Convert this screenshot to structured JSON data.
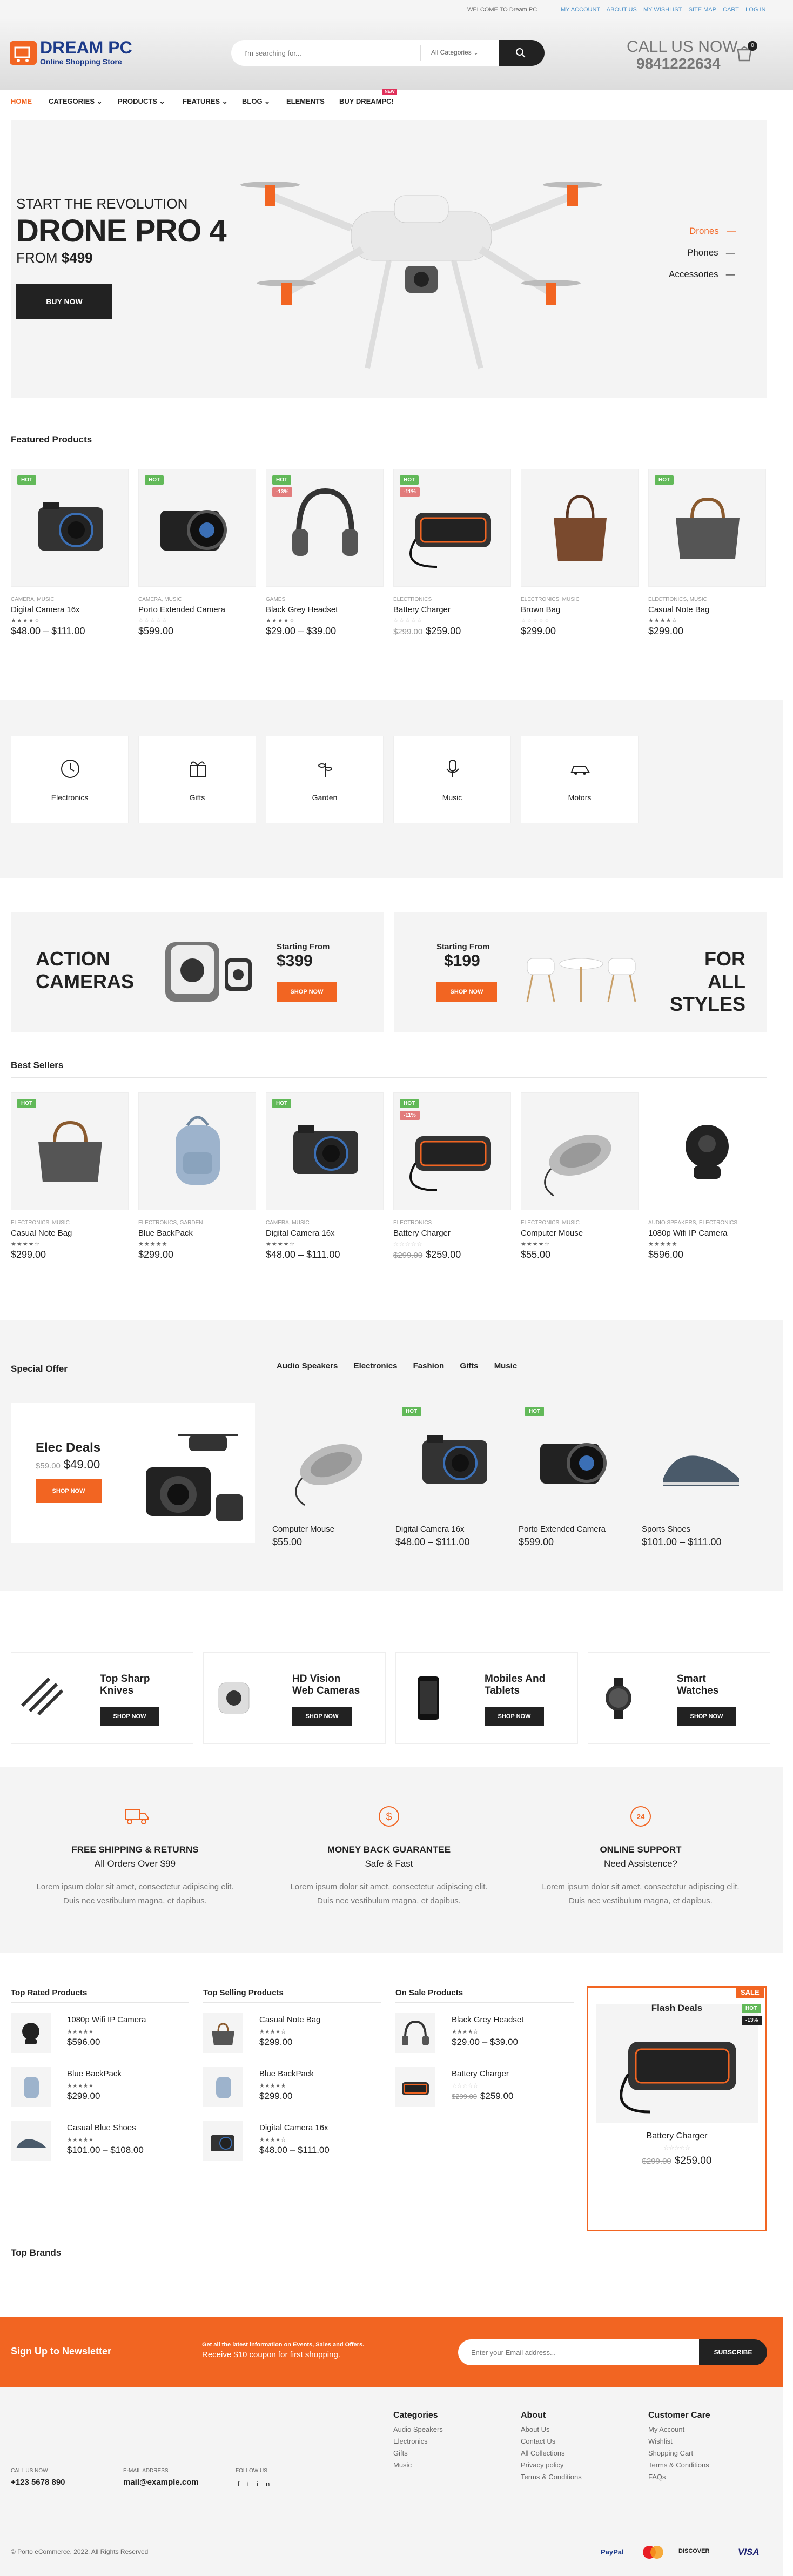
{
  "topbar": {
    "welcome": "WELCOME TO Dream PC",
    "links": [
      "MY ACCOUNT",
      "ABOUT US",
      "MY WISHLIST",
      "SITE MAP",
      "CART",
      "LOG IN"
    ]
  },
  "header": {
    "logo_line1": "DREAM PC",
    "logo_line2": "Online Shopping Store",
    "search_placeholder": "I'm searching for...",
    "category_select": "All Categories",
    "call_label": "CALL US NOW",
    "phone": "9841222634",
    "cart_count": "0"
  },
  "nav": {
    "items": [
      "HOME",
      "CATEGORIES",
      "PRODUCTS",
      "FEATURES",
      "BLOG",
      "ELEMENTS",
      "BUY DREAMPC!"
    ],
    "new_badge": "NEW"
  },
  "hero": {
    "kicker": "START THE REVOLUTION",
    "title": "DRONE PRO 4",
    "from": "FROM",
    "price": "$499",
    "button": "BUY NOW",
    "side_items": [
      "Drones",
      "Phones",
      "Accessories"
    ]
  },
  "featured": {
    "title": "Featured Products",
    "products": [
      {
        "badge": "HOT",
        "badge2": "",
        "cat": "CAMERA, MUSIC",
        "name": "Digital Camera 16x",
        "stars": "★★★★☆",
        "old": "",
        "price": "$48.00 – $111.00"
      },
      {
        "badge": "HOT",
        "badge2": "",
        "cat": "CAMERA, MUSIC",
        "name": "Porto Extended Camera",
        "stars": "☆☆☆☆☆",
        "old": "",
        "price": "$599.00"
      },
      {
        "badge": "HOT",
        "badge2": "-13%",
        "cat": "GAMES",
        "name": "Black Grey Headset",
        "stars": "★★★★☆",
        "old": "",
        "price": "$29.00 – $39.00"
      },
      {
        "badge": "HOT",
        "badge2": "-11%",
        "cat": "ELECTRONICS",
        "name": "Battery Charger",
        "stars": "☆☆☆☆☆",
        "old": "$299.00",
        "price": "$259.00"
      },
      {
        "badge": "",
        "badge2": "",
        "cat": "ELECTRONICS, MUSIC",
        "name": "Brown Bag",
        "stars": "☆☆☆☆☆",
        "old": "",
        "price": "$299.00"
      },
      {
        "badge": "HOT",
        "badge2": "",
        "cat": "ELECTRONICS, MUSIC",
        "name": "Casual Note Bag",
        "stars": "★★★★☆",
        "old": "",
        "price": "$299.00"
      }
    ]
  },
  "categories": [
    "Electronics",
    "Gifts",
    "Garden",
    "Music",
    "Motors"
  ],
  "promo": {
    "left_title1": "ACTION",
    "left_title2": "CAMERAS",
    "left_from": "Starting From",
    "left_price": "$399",
    "left_button": "SHOP NOW",
    "right_from": "Starting From",
    "right_price": "$199",
    "right_button": "SHOP NOW",
    "right_title1": "FOR ALL",
    "right_title2": "STYLES"
  },
  "bestsellers": {
    "title": "Best Sellers",
    "products": [
      {
        "badge": "HOT",
        "badge2": "",
        "cat": "ELECTRONICS, MUSIC",
        "name": "Casual Note Bag",
        "stars": "★★★★☆",
        "old": "",
        "price": "$299.00"
      },
      {
        "badge": "",
        "badge2": "",
        "cat": "ELECTRONICS, GARDEN",
        "name": "Blue BackPack",
        "stars": "★★★★★",
        "old": "",
        "price": "$299.00"
      },
      {
        "badge": "HOT",
        "badge2": "",
        "cat": "CAMERA, MUSIC",
        "name": "Digital Camera 16x",
        "stars": "★★★★☆",
        "old": "",
        "price": "$48.00 – $111.00"
      },
      {
        "badge": "HOT",
        "badge2": "-11%",
        "cat": "ELECTRONICS",
        "name": "Battery Charger",
        "stars": "☆☆☆☆☆",
        "old": "$299.00",
        "price": "$259.00"
      },
      {
        "badge": "",
        "badge2": "",
        "cat": "ELECTRONICS, MUSIC",
        "name": "Computer Mouse",
        "stars": "★★★★☆",
        "old": "",
        "price": "$55.00"
      },
      {
        "badge": "",
        "badge2": "",
        "cat": "AUDIO SPEAKERS, ELECTRONICS",
        "name": "1080p Wifi IP Camera",
        "stars": "★★★★★",
        "old": "",
        "price": "$596.00"
      }
    ]
  },
  "special": {
    "title": "Special Offer",
    "tabs": [
      "Audio Speakers",
      "Electronics",
      "Fashion",
      "Gifts",
      "Music"
    ],
    "deal_title": "Elec Deals",
    "deal_old": "$59.00",
    "deal_price": "$49.00",
    "deal_button": "SHOP NOW",
    "products": [
      {
        "badge": "",
        "name": "Computer Mouse",
        "price": "$55.00"
      },
      {
        "badge": "HOT",
        "name": "Digital Camera 16x",
        "price": "$48.00 – $111.00"
      },
      {
        "badge": "HOT",
        "name": "Porto Extended Camera",
        "price": "$599.00"
      },
      {
        "badge": "",
        "name": "Sports Shoes",
        "price": "$101.00 – $111.00"
      }
    ]
  },
  "banners": [
    {
      "line1": "Top Sharp",
      "line2": "Knives",
      "button": "SHOP NOW"
    },
    {
      "line1": "HD Vision",
      "line2": "Web Cameras",
      "button": "SHOP NOW"
    },
    {
      "line1": "Mobiles And",
      "line2": "Tablets",
      "button": "SHOP NOW"
    },
    {
      "line1": "Smart",
      "line2": "Watches",
      "button": "SHOP NOW"
    }
  ],
  "features": [
    {
      "title": "FREE SHIPPING & RETURNS",
      "sub": "All Orders Over $99",
      "text1": "Lorem ipsum dolor sit amet, consectetur adipiscing elit.",
      "text2": "Duis nec vestibulum magna, et dapibus."
    },
    {
      "title": "MONEY BACK GUARANTEE",
      "sub": "Safe & Fast",
      "text1": "Lorem ipsum dolor sit amet, consectetur adipiscing elit.",
      "text2": "Duis nec vestibulum magna, et dapibus."
    },
    {
      "title": "ONLINE SUPPORT",
      "sub": "Need Assistence?",
      "text1": "Lorem ipsum dolor sit amet, consectetur adipiscing elit.",
      "text2": "Duis nec vestibulum magna, et dapibus."
    }
  ],
  "lists": [
    {
      "title": "Top Rated Products",
      "items": [
        {
          "name": "1080p Wifi IP Camera",
          "stars": "★★★★★",
          "price": "$596.00"
        },
        {
          "name": "Blue BackPack",
          "stars": "★★★★★",
          "price": "$299.00"
        },
        {
          "name": "Casual Blue Shoes",
          "stars": "★★★★★",
          "price": "$101.00 – $108.00"
        }
      ]
    },
    {
      "title": "Top Selling Products",
      "items": [
        {
          "name": "Casual Note Bag",
          "stars": "★★★★☆",
          "price": "$299.00"
        },
        {
          "name": "Blue BackPack",
          "stars": "★★★★★",
          "price": "$299.00"
        },
        {
          "name": "Digital Camera 16x",
          "stars": "★★★★☆",
          "price": "$48.00 – $111.00"
        }
      ]
    },
    {
      "title": "On Sale Products",
      "items": [
        {
          "name": "Black Grey Headset",
          "stars": "★★★★☆",
          "price": "$29.00 – $39.00"
        },
        {
          "name": "Battery Charger",
          "stars": "☆☆☆☆☆",
          "old": "$299.00",
          "price": "$259.00"
        }
      ]
    }
  ],
  "flash": {
    "title": "Flash Deals",
    "sale": "SALE",
    "hot": "HOT",
    "pct": "-13%",
    "name": "Battery Charger",
    "old": "$299.00",
    "price": "$259.00",
    "stars": "☆☆☆☆☆"
  },
  "brands": {
    "title": "Top Brands"
  },
  "newsletter": {
    "title": "Sign Up to Newsletter",
    "line1": "Get all the latest information on Events, Sales and Offers.",
    "line2": "Receive $10 coupon for first shopping.",
    "placeholder": "Enter your Email address...",
    "button": "SUBSCRIBE"
  },
  "footer": {
    "call_label": "CALL US NOW",
    "phone": "+123 5678 890",
    "email_label": "E-MAIL ADDRESS",
    "email": "mail@example.com",
    "follow_label": "FOLLOW US",
    "col1": {
      "title": "Categories",
      "links": [
        "Audio Speakers",
        "Electronics",
        "Gifts",
        "Music"
      ]
    },
    "col2": {
      "title": "About",
      "links": [
        "About Us",
        "Contact Us",
        "All Collections",
        "Privacy policy",
        "Terms & Conditions"
      ]
    },
    "col3": {
      "title": "Customer Care",
      "links": [
        "My Account",
        "Wishlist",
        "Shopping Cart",
        "Terms & Conditions",
        "FAQs"
      ]
    },
    "copyright": "© Porto eCommerce. 2022. All Rights Reserved",
    "payments": [
      "PayPal",
      "Mastercard",
      "DISCOVER",
      "VISA"
    ]
  },
  "colors": {
    "accent": "#f26522",
    "hot": "#62b959",
    "sale": "#e27c7c",
    "dark": "#222222"
  }
}
